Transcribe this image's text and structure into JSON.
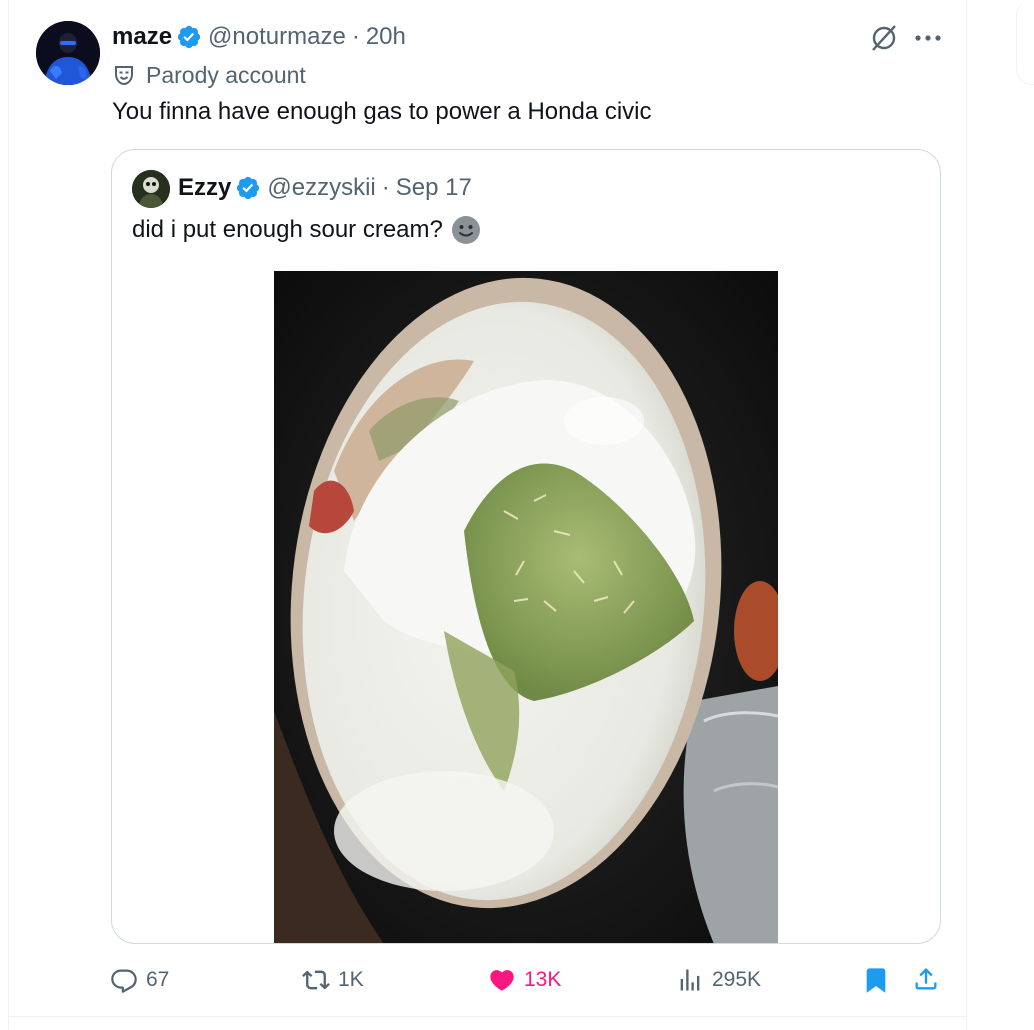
{
  "tweet": {
    "author_name": "maze",
    "author_handle": "@noturmaze",
    "separator": "·",
    "time": "20h",
    "label": "Parody account",
    "text": "You finna have enough gas to power a Honda civic"
  },
  "quoted": {
    "author_name": "Ezzy",
    "author_handle": "@ezzyskii",
    "separator": "·",
    "time": "Sep 17",
    "text": "did i put enough sour cream?",
    "emoji": "slightly-smiling-face-icon"
  },
  "actions": {
    "replies": "67",
    "reposts": "1K",
    "likes": "13K",
    "views": "295K"
  },
  "colors": {
    "verified": "#1d9bf0",
    "like": "#f91880",
    "bookmark": "#1d9bf0",
    "text_secondary": "#536471",
    "border": "#cfd9de"
  }
}
